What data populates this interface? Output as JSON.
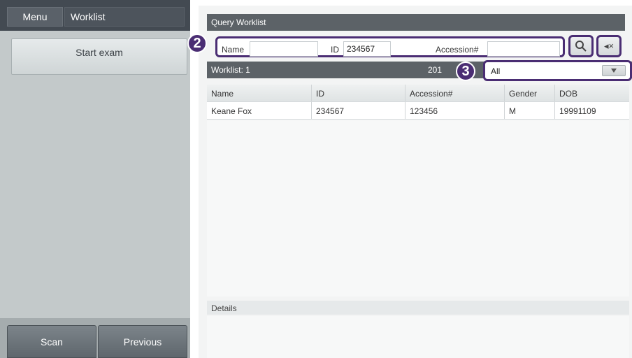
{
  "sidebar": {
    "menu_label": "Menu",
    "worklist_label": "Worklist",
    "start_exam_label": "Start exam",
    "scan_label": "Scan",
    "previous_label": "Previous"
  },
  "query": {
    "title": "Query Worklist",
    "name_label": "Name",
    "name_value": "",
    "id_label": "ID",
    "id_value": "234567",
    "accession_label": "Accession#",
    "accession_value": "",
    "search_icon": "search-icon",
    "clear_icon": "clear-back-icon",
    "clear_glyph": "◂×"
  },
  "worklist": {
    "count_label": "Worklist: 1",
    "date_partial": "201",
    "filter_value": "All",
    "filter_icon": "filter-icon",
    "columns": [
      "Name",
      "ID",
      "Accession#",
      "Gender",
      "DOB"
    ],
    "rows": [
      [
        "Keane Fox",
        "234567",
        "123456",
        "M",
        "19991109"
      ]
    ]
  },
  "details": {
    "label": "Details"
  },
  "callouts": {
    "two": "2",
    "three": "3"
  },
  "colors": {
    "callout": "#4a2d73",
    "header_bar": "#5c6267",
    "sidebar_bg": "#c3c9ca"
  }
}
